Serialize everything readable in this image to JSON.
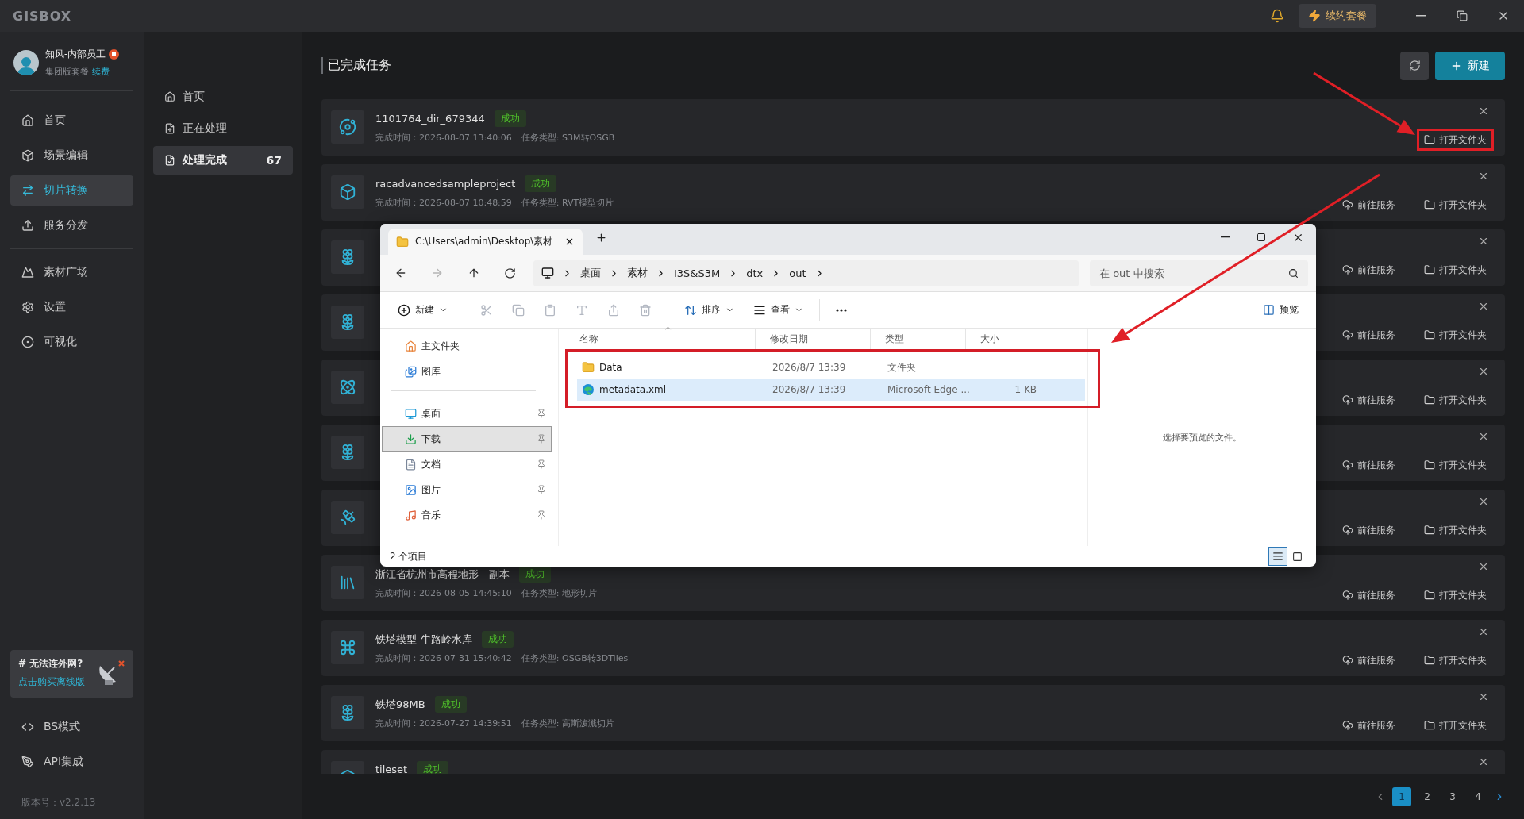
{
  "app": {
    "logo": "GISBOX",
    "renew_button": "续约套餐"
  },
  "user": {
    "name": "知风-内部员工",
    "plan": "集团版套餐",
    "renew_link": "续费"
  },
  "nav_groups": [
    [
      {
        "label": "首页",
        "selected": false
      },
      {
        "label": "场景编辑",
        "selected": false
      },
      {
        "label": "切片转换",
        "selected": true
      },
      {
        "label": "服务分发",
        "selected": false
      }
    ],
    [
      {
        "label": "素材广场",
        "selected": false
      },
      {
        "label": "设置",
        "selected": false
      },
      {
        "label": "可视化",
        "selected": false
      }
    ]
  ],
  "promo": {
    "title": "# 无法连外网?",
    "link": "点击购买离线版"
  },
  "bottom_nav": [
    {
      "label": "BS模式"
    },
    {
      "label": "API集成"
    }
  ],
  "version": "版本号：v2.2.13",
  "subnav": [
    {
      "label": "首页",
      "selected": false
    },
    {
      "label": "正在处理",
      "selected": false
    },
    {
      "label": "处理完成",
      "selected": true,
      "count": "67"
    }
  ],
  "page_title": "已完成任务",
  "new_button": "新建",
  "tasks": [
    {
      "name": "1101764_dir_679344",
      "status": "成功",
      "completed": "完成时间：2026-08-07 13:40:06",
      "type": "任务类型: S3M转OSGB",
      "actions": [
        {
          "kind": "folder",
          "label": "打开文件夹",
          "annotated": true
        }
      ]
    },
    {
      "name": "racadvancedsampleproject",
      "status": "成功",
      "completed": "完成时间：2026-08-07 10:48:59",
      "type": "任务类型: RVT模型切片",
      "actions": [
        {
          "kind": "service",
          "label": "前往服务",
          "annotated": false
        },
        {
          "kind": "folder",
          "label": "打开文件夹",
          "annotated": false
        }
      ]
    },
    {
      "actions": [
        {
          "kind": "service",
          "label": "前往服务",
          "annotated": false
        },
        {
          "kind": "folder",
          "label": "打开文件夹",
          "annotated": false
        }
      ]
    },
    {
      "actions": [
        {
          "kind": "service",
          "label": "前往服务",
          "annotated": false
        },
        {
          "kind": "folder",
          "label": "打开文件夹",
          "annotated": false
        }
      ]
    },
    {
      "actions": [
        {
          "kind": "service",
          "label": "前往服务",
          "annotated": false
        },
        {
          "kind": "folder",
          "label": "打开文件夹",
          "annotated": false
        }
      ]
    },
    {
      "actions": [
        {
          "kind": "service",
          "label": "前往服务",
          "annotated": false
        },
        {
          "kind": "folder",
          "label": "打开文件夹",
          "annotated": false
        }
      ]
    },
    {
      "actions": [
        {
          "kind": "service",
          "label": "前往服务",
          "annotated": false
        },
        {
          "kind": "folder",
          "label": "打开文件夹",
          "annotated": false
        }
      ]
    },
    {
      "name": "浙江省杭州市高程地形 - 副本",
      "status": "成功",
      "completed": "完成时间：2026-08-05 14:45:10",
      "type": "任务类型: 地形切片",
      "actions": [
        {
          "kind": "service",
          "label": "前往服务",
          "annotated": false
        },
        {
          "kind": "folder",
          "label": "打开文件夹",
          "annotated": false
        }
      ]
    },
    {
      "name": "铁塔模型-牛路岭水库",
      "status": "成功",
      "completed": "完成时间：2026-07-31 15:40:42",
      "type": "任务类型: OSGB转3DTiles",
      "actions": [
        {
          "kind": "service",
          "label": "前往服务",
          "annotated": false
        },
        {
          "kind": "folder",
          "label": "打开文件夹",
          "annotated": false
        }
      ]
    },
    {
      "name": "铁塔98MB",
      "status": "成功",
      "completed": "完成时间：2026-07-27 14:39:51",
      "type": "任务类型: 高斯泼溅切片",
      "actions": [
        {
          "kind": "service",
          "label": "前往服务",
          "annotated": false
        },
        {
          "kind": "folder",
          "label": "打开文件夹",
          "annotated": false
        }
      ]
    },
    {
      "name": "tileset",
      "status": "成功"
    }
  ],
  "pagination": [
    {
      "label": "1",
      "selected": true
    },
    {
      "label": "2",
      "selected": false
    },
    {
      "label": "3",
      "selected": false
    },
    {
      "label": "4",
      "selected": false
    }
  ],
  "explorer": {
    "tab_title": "C:\\Users\\admin\\Desktop\\素材",
    "breadcrumb": [
      "桌面",
      "素材",
      "I3S&S3M",
      "dtx",
      "out"
    ],
    "search": {
      "placeholder": "在 out 中搜索"
    },
    "toolbar": {
      "new": "新建",
      "sort": "排序",
      "view": "查看",
      "preview": "预览"
    },
    "nav_top": [
      {
        "label": "主文件夹",
        "pinned": false,
        "selected": false
      },
      {
        "label": "图库",
        "pinned": false,
        "selected": false
      }
    ],
    "nav_quick": [
      {
        "label": "桌面",
        "pinned": true,
        "selected": false
      },
      {
        "label": "下载",
        "pinned": true,
        "selected": true
      },
      {
        "label": "文档",
        "pinned": true,
        "selected": false
      },
      {
        "label": "图片",
        "pinned": true,
        "selected": false
      },
      {
        "label": "音乐",
        "pinned": true,
        "selected": false
      }
    ],
    "columns": [
      "名称",
      "修改日期",
      "类型",
      "大小"
    ],
    "files_annotated": true,
    "files": [
      {
        "name": "Data",
        "kind": "folder",
        "modified": "2026/8/7 13:39",
        "type": "文件夹",
        "selected": false
      },
      {
        "name": "metadata.xml",
        "kind": "web",
        "modified": "2026/8/7 13:39",
        "type": "Microsoft Edge ...",
        "size": "1 KB",
        "selected": true
      }
    ],
    "preview_hint": "选择要预览的文件。",
    "status": "2 个项目",
    "view_modes": [
      {
        "selected": true
      },
      {
        "selected": false
      }
    ]
  }
}
